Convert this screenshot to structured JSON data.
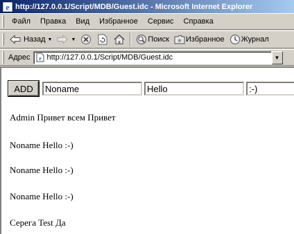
{
  "window": {
    "title": "http://127.0.0.1/Script/MDB/Guest.idc - Microsoft Internet Explorer"
  },
  "menu": [
    "Файл",
    "Правка",
    "Вид",
    "Избранное",
    "Сервис",
    "Справка"
  ],
  "toolbar": {
    "back": "Назад",
    "search": "Поиск",
    "favorites": "Избранное",
    "history": "Журнал"
  },
  "address": {
    "label": "Адрес",
    "url": "http://127.0.0.1/Script/MDB/Guest.idc"
  },
  "form": {
    "add_label": "ADD",
    "name_value": "Noname",
    "subject_value": "Hello",
    "message_value": ":-)"
  },
  "entries": [
    "Admin Привет всем Привет",
    "Noname Hello :-)",
    "Noname Hello :-)",
    "Noname Hello :-)",
    "Серега Test Да"
  ],
  "colors": {
    "titlebar_start": "#0a246a",
    "titlebar_end": "#a6caf0",
    "chrome": "#d4d0c8"
  }
}
